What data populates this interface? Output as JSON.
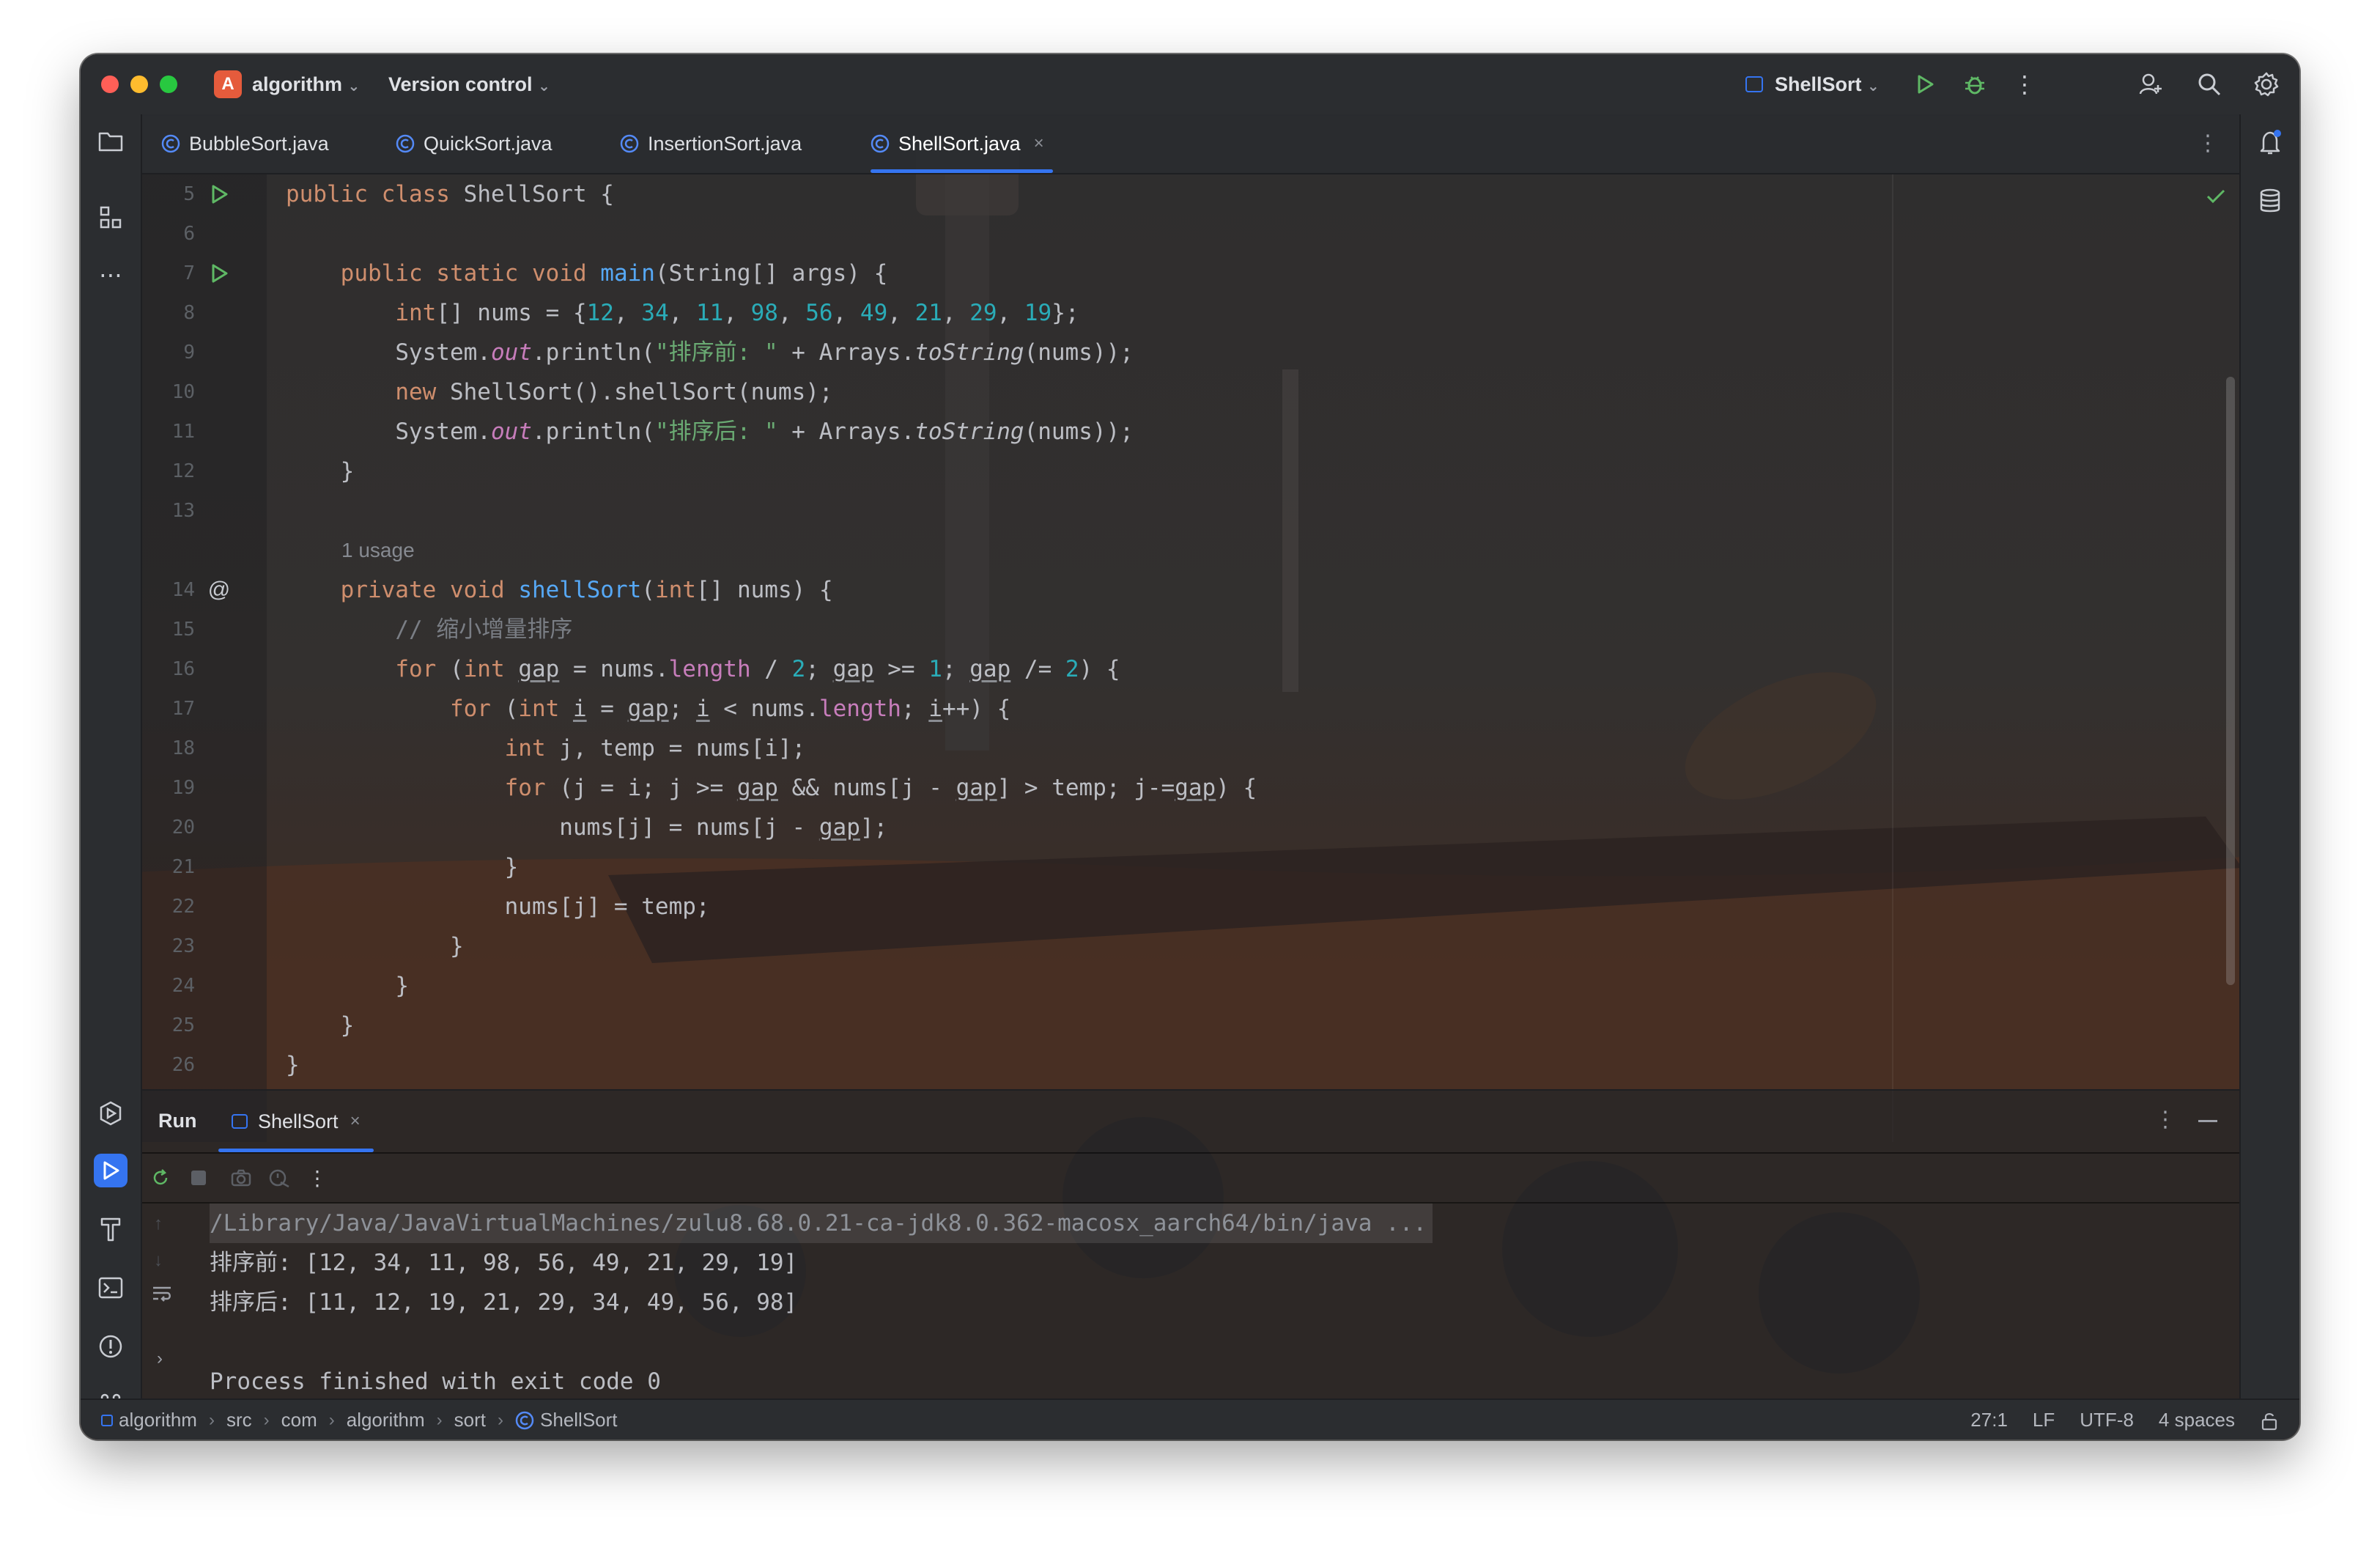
{
  "titlebar": {
    "project_badge": "A",
    "project_name": "algorithm",
    "version_control": "Version control",
    "run_config": "ShellSort"
  },
  "tabs": [
    {
      "label": "BubbleSort.java",
      "active": false
    },
    {
      "label": "QuickSort.java",
      "active": false
    },
    {
      "label": "InsertionSort.java",
      "active": false
    },
    {
      "label": "ShellSort.java",
      "active": true
    }
  ],
  "editor": {
    "usage_hint": "1 usage",
    "line_numbers": [
      "5",
      "6",
      "7",
      "8",
      "9",
      "10",
      "11",
      "12",
      "13",
      "14",
      "15",
      "16",
      "17",
      "18",
      "19",
      "20",
      "21",
      "22",
      "23",
      "24",
      "25",
      "26"
    ],
    "code": {
      "l5": [
        "public",
        "class",
        "ShellSort {"
      ],
      "l7": [
        "public",
        "static",
        "void",
        "main",
        "(String[] args) {"
      ],
      "l8": [
        "int",
        "[] nums = {",
        "12",
        "34",
        "11",
        "98",
        "56",
        "49",
        "21",
        "29",
        "19",
        "};"
      ],
      "l9": [
        "System.",
        "out",
        ".println(",
        "\"排序前: \"",
        " + Arrays.",
        "toString",
        "(nums));"
      ],
      "l10": [
        "new",
        " ShellSort().shellSort(nums);"
      ],
      "l11": [
        "System.",
        "out",
        ".println(",
        "\"排序后: \"",
        " + Arrays.",
        "toString",
        "(nums));"
      ],
      "l12": "}",
      "l14": [
        "private",
        "void",
        "shellSort",
        "(",
        "int",
        "[] nums) {"
      ],
      "l15": "// 缩小增量排序",
      "l16": [
        "for",
        " (",
        "int",
        "gap",
        " = nums.",
        "length",
        " / ",
        "2",
        "; ",
        "gap",
        " >= ",
        "1",
        "; ",
        "gap",
        " /= ",
        "2",
        ") {"
      ],
      "l17": [
        "for",
        " (",
        "int",
        "i",
        " = ",
        "gap",
        "; ",
        "i",
        " < nums.",
        "length",
        "; ",
        "i",
        "++) {"
      ],
      "l18": [
        "int",
        " j, temp = nums[i];"
      ],
      "l19": [
        "for",
        " (j = i; j >= ",
        "gap",
        " && nums[j - ",
        "gap",
        "] > temp; j-=",
        "gap",
        ") {"
      ],
      "l20": [
        "nums[j] = nums[j - ",
        "gap",
        "];"
      ],
      "l21": "}",
      "l22": "nums[j] = temp;",
      "l23": "}",
      "l24": "}",
      "l25": "}",
      "l26": "}"
    }
  },
  "run_panel": {
    "title": "Run",
    "tab_label": "ShellSort",
    "console": [
      "/Library/Java/JavaVirtualMachines/zulu8.68.0.21-ca-jdk8.0.362-macosx_aarch64/bin/java ...",
      "排序前: [12, 34, 11, 98, 56, 49, 21, 29, 19]",
      "排序后: [11, 12, 19, 21, 29, 34, 49, 56, 98]",
      "",
      "Process finished with exit code 0"
    ]
  },
  "statusbar": {
    "breadcrumbs": [
      "algorithm",
      "src",
      "com",
      "algorithm",
      "sort",
      "ShellSort"
    ],
    "position": "27:1",
    "line_ending": "LF",
    "encoding": "UTF-8",
    "indent": "4 spaces"
  },
  "colors": {
    "accent": "#3574f0",
    "keyword": "#cf8e6d",
    "function": "#56a8f5",
    "number": "#2aacb8",
    "string": "#6aab73",
    "field": "#c77dbb",
    "run_green": "#5fb865"
  },
  "icons": [
    "folder-icon",
    "structure-icon",
    "more-icon",
    "services-icon",
    "run-tool-icon",
    "build-icon",
    "terminal-icon",
    "problems-icon",
    "git-icon",
    "notifications-icon",
    "database-icon",
    "run-icon",
    "debug-icon",
    "add-user-icon",
    "search-icon",
    "settings-icon",
    "rerun-icon",
    "stop-icon",
    "camera-icon",
    "exit-icon",
    "class-icon",
    "soft-wrap-icon",
    "up-arrow-icon",
    "down-arrow-icon",
    "chevron-right-icon",
    "lock-icon",
    "check-icon",
    "at-sign-icon"
  ]
}
